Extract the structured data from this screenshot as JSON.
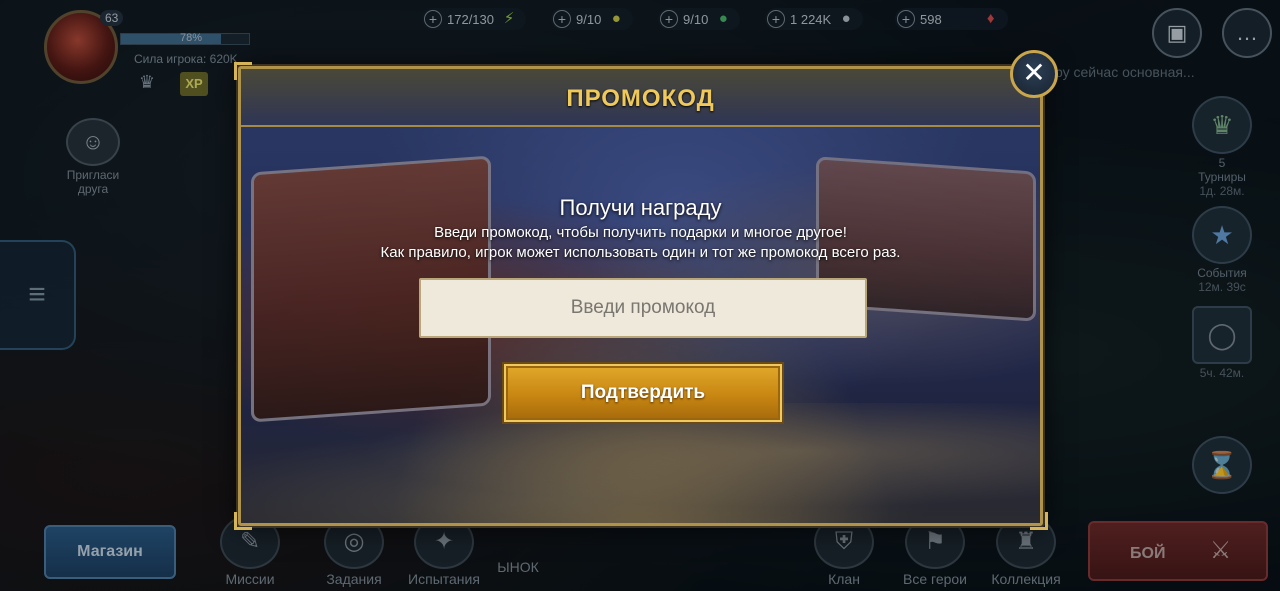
{
  "player": {
    "level": "63",
    "xp_percent": "78%",
    "xp_fill_fraction": 0.78,
    "power_label": "Сила игрока: 620K"
  },
  "resources": [
    {
      "value": "172/130",
      "icon": "lightning-icon",
      "color": "#9bd14a"
    },
    {
      "value": "9/10",
      "icon": "key-icon",
      "color": "#c8c84a"
    },
    {
      "value": "9/10",
      "icon": "gem-key-icon",
      "color": "#4ab86a"
    },
    {
      "value": "1 224K",
      "icon": "silver-coin-icon",
      "color": "#b9c3cc"
    },
    {
      "value": "598",
      "icon": "ruby-icon",
      "color": "#d84a4a"
    }
  ],
  "side_hint": "ру сейчас основная...",
  "invite": {
    "label": "Пригласи друга"
  },
  "right_widgets": {
    "tournaments": {
      "count": "5",
      "label": "Турниры",
      "timer": "1д. 28м."
    },
    "events": {
      "label": "События",
      "timer": "12м. 39с"
    },
    "ring": {
      "timer": "5ч. 42м."
    }
  },
  "bottom_nav": {
    "shop": "Магазин",
    "missions": "Миссии",
    "tasks": "Задания",
    "trials": "Испытания",
    "market": "ЫНОК",
    "clan": "Клан",
    "all_heroes": "Все герои",
    "collection": "Коллекция",
    "battle": "БОЙ"
  },
  "modal": {
    "title": "ПРОМОКОД",
    "reward_title": "Получи награду",
    "description_line1": "Введи промокод, чтобы получить подарки и многое другое!",
    "description_line2": "Как правило, игрок может использовать один и тот же промокод всего раз.",
    "input_placeholder": "Введи промокод",
    "input_value": "",
    "confirm_label": "Подтвердить",
    "close_glyph": "✕",
    "accent_color": "#efc95a",
    "button_color": "#c88612"
  }
}
